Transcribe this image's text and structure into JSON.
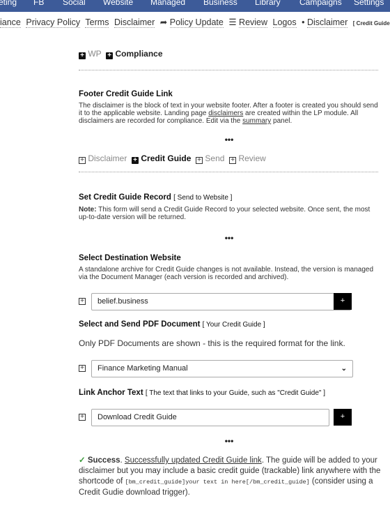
{
  "nav": {
    "items": [
      "eting",
      "FB",
      "Social",
      "Website",
      "Managed",
      "Business",
      "Library",
      "Campaigns",
      "Settings"
    ],
    "bg": "#3d5b99"
  },
  "subnav": {
    "items": [
      "iance",
      "Privacy Policy",
      "Terms",
      "Disclaimer",
      "Policy Update",
      "Review",
      "Logos",
      "Disclaimer"
    ],
    "current": "[ Credit Guide ]"
  },
  "toptabs": {
    "wp": "WP",
    "compliance": "Compliance"
  },
  "footer": {
    "title": "Footer Credit Guide Link",
    "p1": "The disclaimer is the block of text in your website footer. After a footer is created you should send it to the applicable website. Landing page ",
    "link1": "disclaimers",
    "p2": " are created within the LP module. All disclaimers are recorded for compliance. Edit via the ",
    "link2": "summary",
    "p3": " panel."
  },
  "dots": "•••",
  "subtabs": {
    "disclaimer": "Disclaimer",
    "credit_guide": "Credit Guide",
    "send": "Send",
    "review": "Review"
  },
  "record": {
    "title": "Set Credit Guide Record",
    "bracket": "[ Send to Website ]",
    "note_label": "Note:",
    "note": " This form will send a Credit Guide Record to your selected website. Once sent, the most up-to-date version will be returned."
  },
  "dest": {
    "title": "Select Destination Website",
    "desc": "A standalone archive for Credit Guide changes is not available. Instead, the version is managed via the Document Manager (each version is recorded and archived).",
    "value": "belief.business",
    "button": "+"
  },
  "pdf": {
    "title": "Select and Send PDF Document",
    "bracket": "[ Your Credit Guide ]",
    "desc": "Only PDF Documents are shown - this is the required format for the link.",
    "value": "Finance Marketing Manual"
  },
  "anchor": {
    "title": "Link Anchor Text",
    "bracket": "[ The text that links to your Guide, such as \"Credit Guide\" ]",
    "value": "Download Credit Guide",
    "button": "+"
  },
  "success": {
    "label": "Success",
    "link": "Successfully updated Credit Guide link",
    "t1": ". The guide will be added to your disclaimer but you may include a basic credit guide (trackable) link anywhere with the shortcode of ",
    "code": "[bm_credit_guide]your text in here[/bm_credit_guide]",
    "t2": " (consider using a Credit Gudie download trigger).",
    "check_color": "#3a9a3a"
  }
}
